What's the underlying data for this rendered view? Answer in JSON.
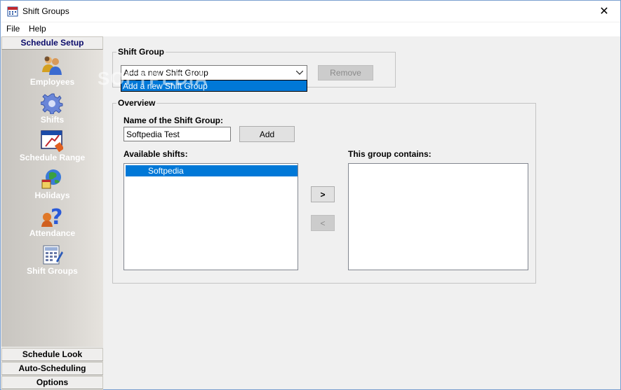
{
  "window": {
    "title": "Shift Groups",
    "close_glyph": "✕"
  },
  "menu": {
    "file": "File",
    "help": "Help"
  },
  "sidebar": {
    "top_header": "Schedule Setup",
    "items": [
      {
        "label": "Employees",
        "icon": "employees-icon"
      },
      {
        "label": "Shifts",
        "icon": "gear-icon"
      },
      {
        "label": "Schedule Range",
        "icon": "schedule-range-icon"
      },
      {
        "label": "Holidays",
        "icon": "globe-icon"
      },
      {
        "label": "Attendance",
        "icon": "question-icon"
      },
      {
        "label": "Shift Groups",
        "icon": "calculator-icon"
      }
    ],
    "bottom_headers": [
      "Schedule Look",
      "Auto-Scheduling",
      "Options"
    ]
  },
  "shift_group": {
    "title": "Shift Group",
    "combo_value": "Add a new Shift Group",
    "dropdown_option": "Add a new Shift Group",
    "remove_label": "Remove"
  },
  "overview": {
    "title": "Overview",
    "name_label": "Name of the Shift Group:",
    "name_value": "Softpedia Test",
    "add_label": "Add",
    "available_label": "Available shifts:",
    "available_items": [
      "Softpedia"
    ],
    "contains_label": "This group contains:",
    "move_right": ">",
    "move_left": "<"
  },
  "watermark": "SOFTPEDIA"
}
